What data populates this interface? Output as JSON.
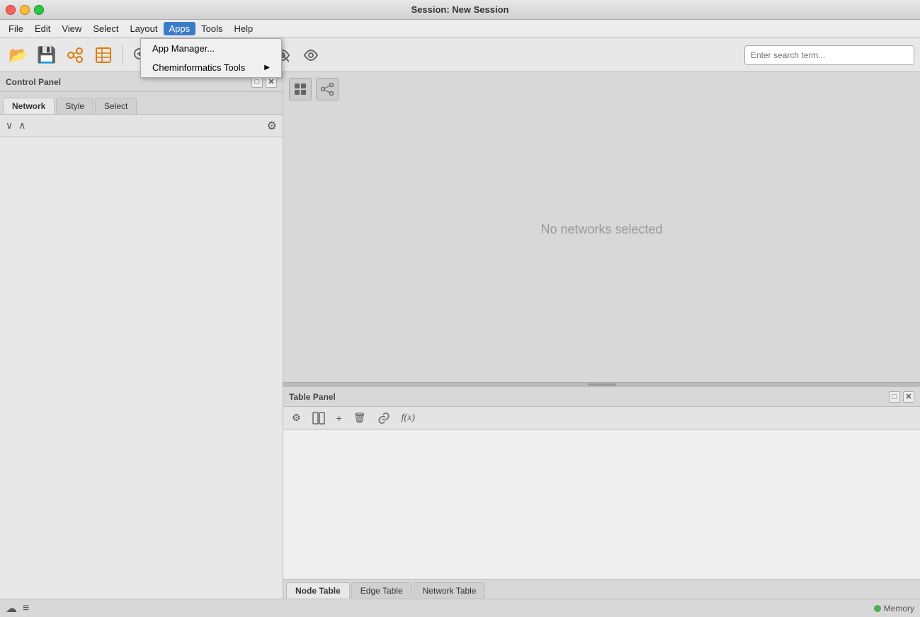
{
  "window": {
    "title": "Session: New Session"
  },
  "menubar": {
    "items": [
      {
        "id": "file",
        "label": "File"
      },
      {
        "id": "edit",
        "label": "Edit"
      },
      {
        "id": "view",
        "label": "View"
      },
      {
        "id": "select",
        "label": "Select"
      },
      {
        "id": "layout",
        "label": "Layout"
      },
      {
        "id": "apps",
        "label": "Apps",
        "active": true
      },
      {
        "id": "tools",
        "label": "Tools"
      },
      {
        "id": "help",
        "label": "Help"
      }
    ]
  },
  "apps_dropdown": {
    "items": [
      {
        "id": "app-manager",
        "label": "App Manager...",
        "has_arrow": false
      },
      {
        "id": "cheminformatics-tools",
        "label": "Cheminformatics Tools",
        "has_arrow": true
      }
    ]
  },
  "toolbar": {
    "buttons": [
      {
        "id": "open",
        "icon": "📂",
        "label": "Open"
      },
      {
        "id": "save",
        "icon": "💾",
        "label": "Save"
      },
      {
        "id": "import-network",
        "icon": "⇄",
        "label": "Import Network"
      },
      {
        "id": "import-table",
        "icon": "⊞",
        "label": "Import Table"
      }
    ],
    "search_placeholder": "Enter search term..."
  },
  "control_panel": {
    "title": "Control Panel",
    "tabs": [
      {
        "id": "network",
        "label": "Network",
        "active": true
      },
      {
        "id": "style",
        "label": "Style"
      },
      {
        "id": "select",
        "label": "Select"
      }
    ]
  },
  "network_view": {
    "empty_message": "No networks selected"
  },
  "table_panel": {
    "title": "Table Panel",
    "tabs": [
      {
        "id": "node-table",
        "label": "Node Table",
        "active": true
      },
      {
        "id": "edge-table",
        "label": "Edge Table"
      },
      {
        "id": "network-table",
        "label": "Network Table"
      }
    ]
  },
  "status_bar": {
    "memory_label": "Memory"
  }
}
